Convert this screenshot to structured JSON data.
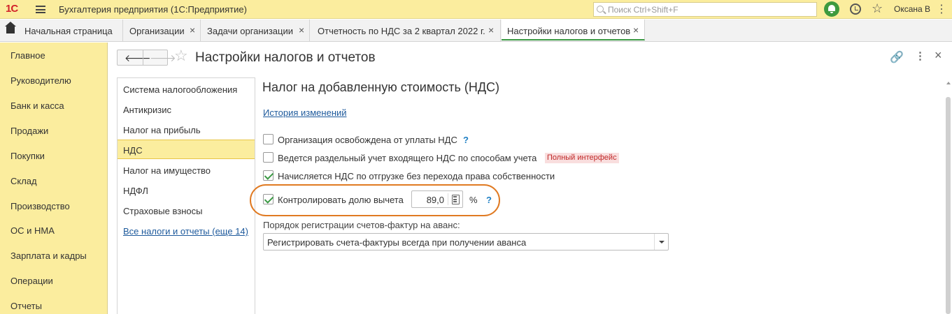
{
  "app": {
    "logo": "1С",
    "title": "Бухгалтерия предприятия  (1С:Предприятие)",
    "search_placeholder": "Поиск Ctrl+Shift+F",
    "user": "Оксана В"
  },
  "tabs": {
    "home": "Начальная страница",
    "items": [
      {
        "label": "Организации",
        "close": "×"
      },
      {
        "label": "Задачи организации",
        "close": "×"
      },
      {
        "label": "Отчетность по НДС за 2 квартал 2022 г.",
        "close": "×"
      },
      {
        "label": "Настройки налогов и отчетов",
        "close": "×"
      }
    ]
  },
  "sidebar": {
    "items": [
      "Главное",
      "Руководителю",
      "Банк и касса",
      "Продажи",
      "Покупки",
      "Склад",
      "Производство",
      "ОС и НМА",
      "Зарплата и кадры",
      "Операции",
      "Отчеты"
    ]
  },
  "page": {
    "title": "Настройки налогов и отчетов"
  },
  "sections": {
    "items": [
      "Система налогообложения",
      "Антикризис",
      "Налог на прибыль",
      "НДС",
      "Налог на имущество",
      "НДФЛ",
      "Страховые взносы"
    ],
    "active": "НДС",
    "all_link": "Все налоги и отчеты (еще 14)"
  },
  "form": {
    "title": "Налог на добавленную стоимость (НДС)",
    "history_link": "История изменений",
    "checkboxes": [
      {
        "label": "Организация освобождена от уплаты НДС",
        "checked": false,
        "help": "?"
      },
      {
        "label": "Ведется раздельный учет входящего НДС по способам учета",
        "checked": false,
        "badge": "Полный интерфейс"
      },
      {
        "label": "Начисляется НДС по отгрузке без перехода права собственности",
        "checked": true
      },
      {
        "label": "Контролировать долю вычета",
        "checked": true,
        "help": "?"
      }
    ],
    "deduction_share": "89,0",
    "deduction_unit": "%",
    "registration_label": "Порядок регистрации счетов-фактур на аванс:",
    "registration_value": "Регистрировать счета-фактуры всегда при получении аванса"
  },
  "colors": {
    "accent_yellow": "#fbed9e",
    "active_green": "#3c9a45",
    "highlight_orange": "#e07a22",
    "link_blue": "#1e5a9c"
  }
}
